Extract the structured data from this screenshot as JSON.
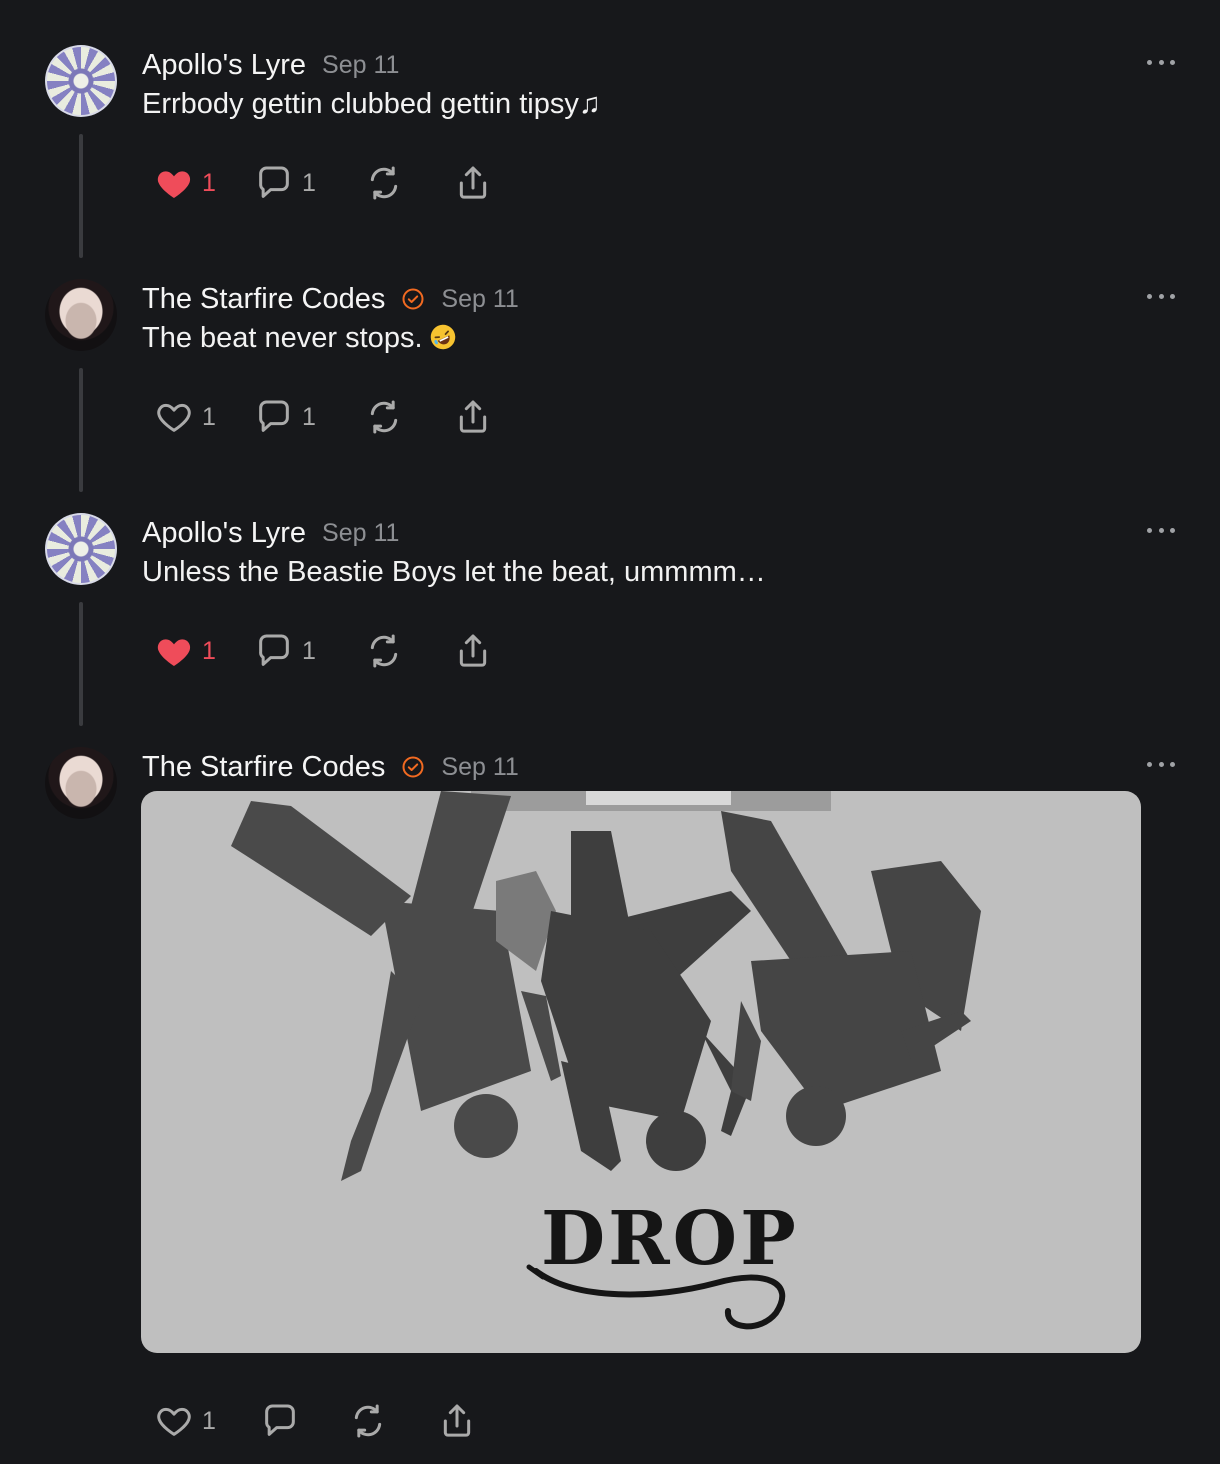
{
  "posts": [
    {
      "author": "Apollo's Lyre",
      "date": "Sep 11",
      "text": "Errbody gettin clubbed gettin tipsy♫",
      "likes": "1",
      "liked": true,
      "replies": "1"
    },
    {
      "author": "The Starfire Codes",
      "date": "Sep 11",
      "verified": true,
      "text": "The beat never stops.",
      "emoji": "rolling-on-floor-laughing",
      "likes": "1",
      "liked": false,
      "replies": "1"
    },
    {
      "author": "Apollo's Lyre",
      "date": "Sep 11",
      "text": "Unless the Beastie Boys let the beat, ummmm…",
      "likes": "1",
      "liked": true,
      "replies": "1"
    },
    {
      "author": "The Starfire Codes",
      "date": "Sep 11",
      "verified": true,
      "image_caption": "DROP",
      "likes": "1",
      "liked": false
    }
  ],
  "colors": {
    "background": "#17181b",
    "like_active": "#ef4c5a",
    "verified_badge": "#f26a21",
    "muted_text": "#8d8f93"
  }
}
